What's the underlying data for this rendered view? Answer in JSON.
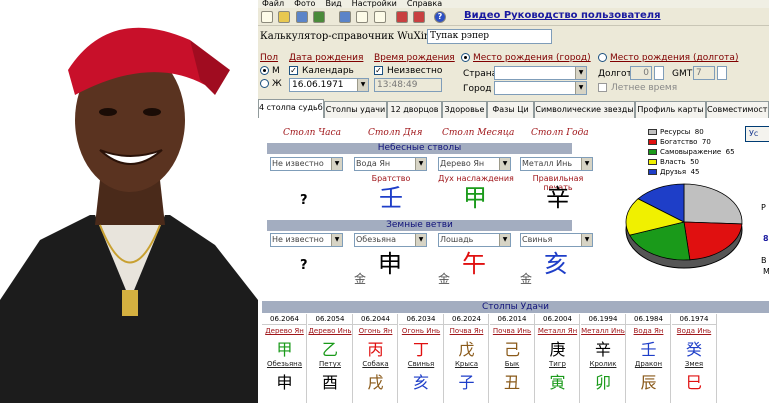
{
  "menu": [
    "Файл",
    "Фото",
    "Вид",
    "Настройки",
    "Справка"
  ],
  "toolbar": {
    "manual_link": "Видео Руководство пользователя",
    "help_glyph": "?"
  },
  "header": {
    "title": "Калькулятор-справочник WuXing",
    "name_value": "Тупак рэпер"
  },
  "form": {
    "sex_label": "Пол",
    "sex_m": "М",
    "sex_f": "Ж",
    "birth_date_label": "Дата рождения",
    "calendar_label": "Календарь",
    "birth_date_value": "16.06.1971",
    "birth_time_label": "Время рождения",
    "unknown_label": "Неизвестно",
    "birth_time_value": "13:48:49",
    "birthplace_city_label": "Место рождения (город)",
    "country_label": "Страна",
    "city_label": "Город",
    "birthplace_lon_label": "Место рождения (долгота)",
    "longitude_label": "Долгота",
    "lon_deg": "0",
    "gmt_label": "GMT",
    "gmt_value": "7",
    "summer_time_label": "Летнее время"
  },
  "tabs": [
    "4 столпа судьбы",
    "Столпы удачи",
    "12 дворцов",
    "Здоровье",
    "Фазы Ци",
    "Символические звезды",
    "Профиль карты",
    "Совместимость"
  ],
  "pillars": {
    "titles": [
      "Столп Часа",
      "Столп Дня",
      "Столп Месяца",
      "Столп Года"
    ],
    "stems_title": "Небесные стволы",
    "branches_title": "Земные ветви",
    "stems": [
      {
        "select": "Не известно",
        "label": "",
        "glyph": "?",
        "color": "#000000"
      },
      {
        "select": "Вода Ян",
        "label": "Братство",
        "glyph": "壬",
        "color": "#1e3ec8"
      },
      {
        "select": "Дерево Ян",
        "label": "Дух наслаждения",
        "glyph": "甲",
        "color": "#1a9a1a"
      },
      {
        "select": "Металл Инь",
        "label": "Правильная печать",
        "glyph": "辛",
        "color": "#000000"
      }
    ],
    "branches": [
      {
        "select": "Не известно",
        "glyph": "?",
        "color": "#000000",
        "small": ""
      },
      {
        "select": "Обезьяна",
        "glyph": "申",
        "color": "#000000",
        "small": "金"
      },
      {
        "select": "Лошадь",
        "glyph": "午",
        "color": "#e01010",
        "small": "金"
      },
      {
        "select": "Свинья",
        "glyph": "亥",
        "color": "#1e3ec8",
        "small": "金"
      }
    ]
  },
  "legend": [
    {
      "label": "Ресурсы",
      "value": "80",
      "color": "#c0c0c0"
    },
    {
      "label": "Богатство",
      "value": "70",
      "color": "#e01010"
    },
    {
      "label": "Самовыражение",
      "value": "65",
      "color": "#1a9a1a"
    },
    {
      "label": "Власть",
      "value": "50",
      "color": "#f0f000"
    },
    {
      "label": "Друзья",
      "value": "45",
      "color": "#1e3ec8"
    }
  ],
  "right_button": "Ус",
  "luck": {
    "title": "Столпы Удачи",
    "columns": [
      {
        "year": "06.2064",
        "stem": "Дерево Ян",
        "stem_glyph": "甲",
        "stem_color": "#1a9a1a",
        "branch": "Обезьяна",
        "branch_glyph": "申",
        "branch_color": "#000000"
      },
      {
        "year": "06.2054",
        "stem": "Дерево Инь",
        "stem_glyph": "乙",
        "stem_color": "#1a9a1a",
        "branch": "Петух",
        "branch_glyph": "酉",
        "branch_color": "#000000"
      },
      {
        "year": "06.2044",
        "stem": "Огонь Ян",
        "stem_glyph": "丙",
        "stem_color": "#e01010",
        "branch": "Собака",
        "branch_glyph": "戌",
        "branch_color": "#8a5a1a"
      },
      {
        "year": "06.2034",
        "stem": "Огонь Инь",
        "stem_glyph": "丁",
        "stem_color": "#e01010",
        "branch": "Свинья",
        "branch_glyph": "亥",
        "branch_color": "#1e3ec8"
      },
      {
        "year": "06.2024",
        "stem": "Почва Ян",
        "stem_glyph": "戊",
        "stem_color": "#8a5a1a",
        "branch": "Крыса",
        "branch_glyph": "子",
        "branch_color": "#1e3ec8"
      },
      {
        "year": "06.2014",
        "stem": "Почва Инь",
        "stem_glyph": "己",
        "stem_color": "#8a5a1a",
        "branch": "Бык",
        "branch_glyph": "丑",
        "branch_color": "#8a5a1a"
      },
      {
        "year": "06.2004",
        "stem": "Металл Ян",
        "stem_glyph": "庚",
        "stem_color": "#000000",
        "branch": "Тигр",
        "branch_glyph": "寅",
        "branch_color": "#1a9a1a"
      },
      {
        "year": "06.1994",
        "stem": "Металл Инь",
        "stem_glyph": "辛",
        "stem_color": "#000000",
        "branch": "Кролик",
        "branch_glyph": "卯",
        "branch_color": "#1a9a1a"
      },
      {
        "year": "06.1984",
        "stem": "Вода Ян",
        "stem_glyph": "壬",
        "stem_color": "#1e3ec8",
        "branch": "Дракон",
        "branch_glyph": "辰",
        "branch_color": "#8a5a1a"
      },
      {
        "year": "06.1974",
        "stem": "Вода Инь",
        "stem_glyph": "癸",
        "stem_color": "#1e3ec8",
        "branch": "Змея",
        "branch_glyph": "巳",
        "branch_color": "#e01010"
      }
    ]
  },
  "pie": {
    "values": [
      80,
      70,
      65,
      50,
      45
    ]
  },
  "side_text": [
    "Р",
    "8",
    "В",
    "М"
  ]
}
